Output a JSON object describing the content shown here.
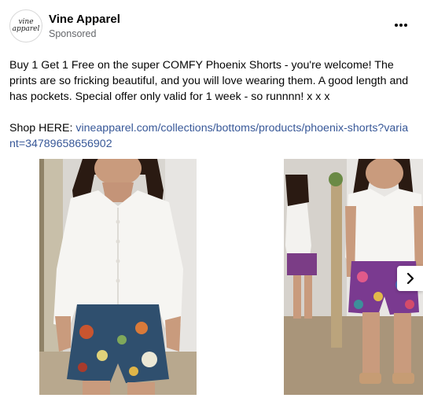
{
  "post": {
    "page_name": "Vine Apparel",
    "avatar_text": "vine\napparel",
    "sponsored_label": "Sponsored",
    "caption": "Buy 1 Get 1 Free on the super COMFY Phoenix Shorts - you're welcome! The prints are so fricking beautiful, and you will love wearing them. A good length and has pockets. Special offer only valid for 1 week - so runnnn! x x x",
    "shop_prefix": "Shop HERE: ",
    "shop_link": "vineapparel.com/collections/bottoms/products/phoenix-shorts?variant=34789658656902"
  },
  "carousel": {
    "cards": [
      {
        "image": "model-white-blouse-blue-floral-shorts"
      },
      {
        "image": "model-white-top-purple-floral-shorts-mirror"
      }
    ],
    "next_icon": "chevron-right-icon"
  },
  "icons": {
    "more": "more-horizontal-icon"
  },
  "colors": {
    "link": "#385898",
    "secondary_text": "#65676b"
  }
}
